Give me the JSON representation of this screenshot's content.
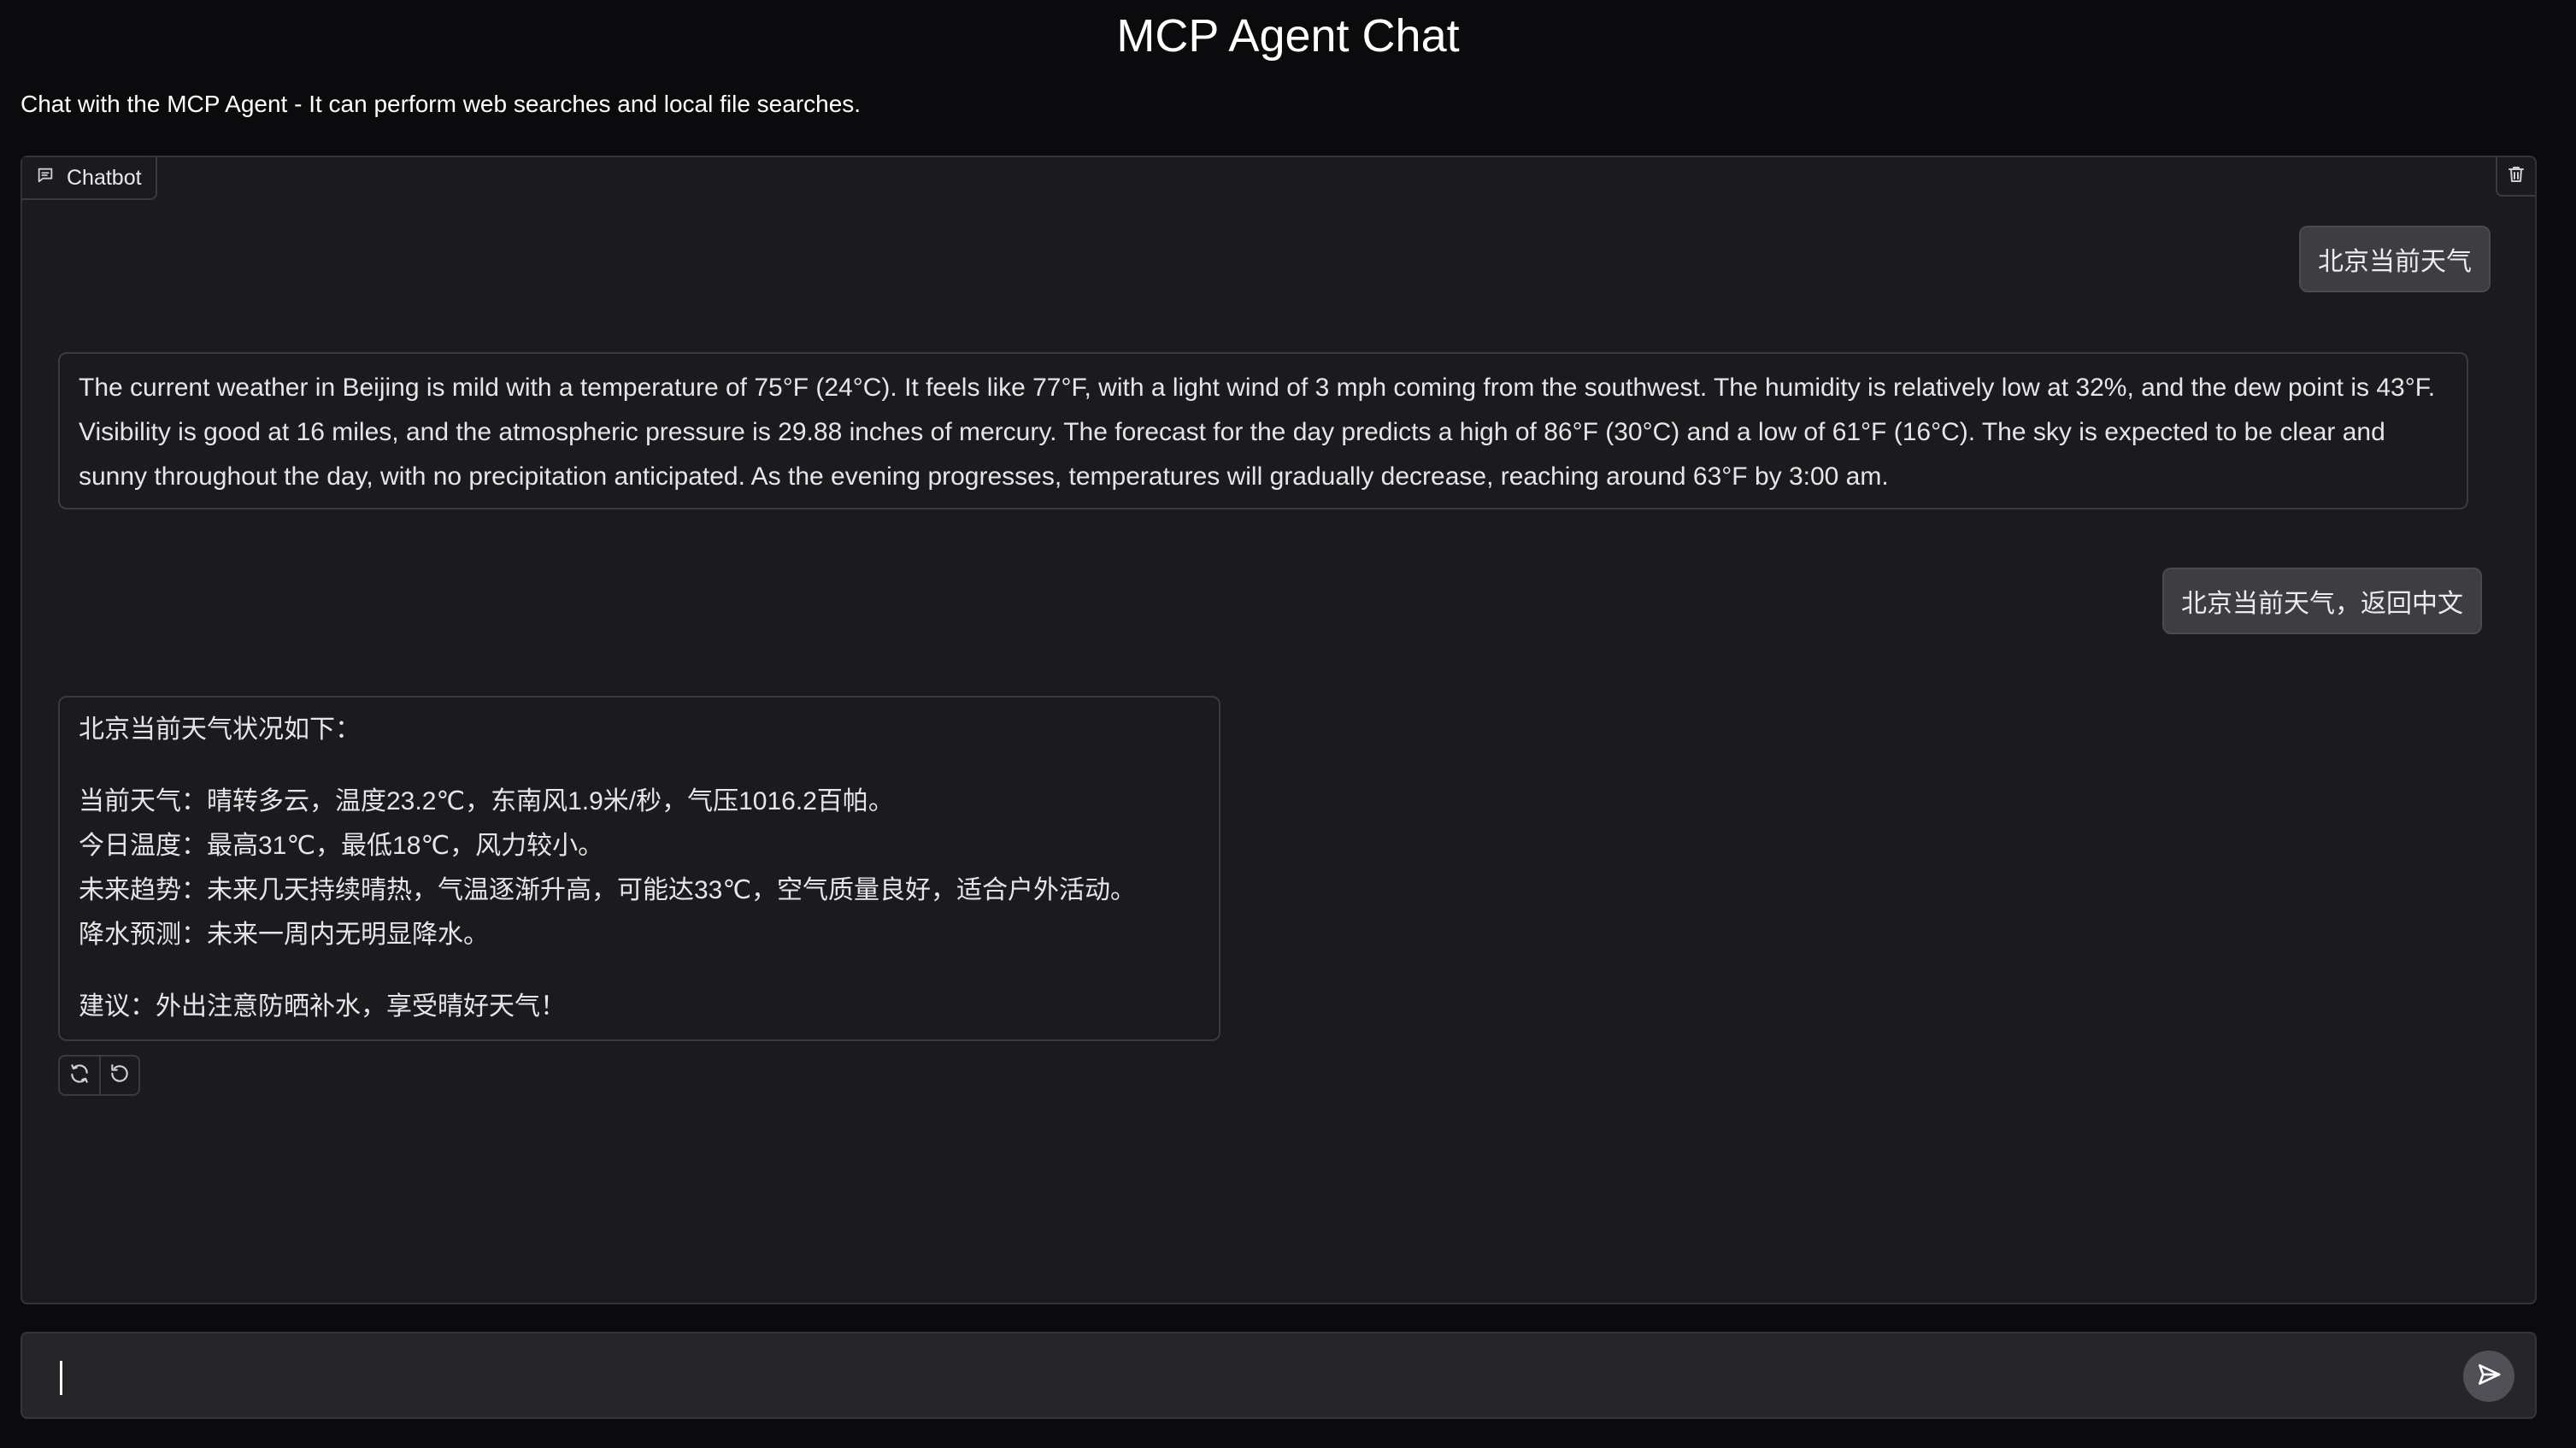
{
  "header": {
    "title": "MCP Agent Chat",
    "description": "Chat with the MCP Agent - It can perform web searches and local file searches."
  },
  "chatbot": {
    "label": "Chatbot",
    "label_icon": "chat-bubble-icon",
    "clear_icon": "trash-icon",
    "messages": [
      {
        "role": "user",
        "text": "北京当前天气"
      },
      {
        "role": "assistant",
        "text": "The current weather in Beijing is mild with a temperature of 75°F (24°C). It feels like 77°F, with a light wind of 3 mph coming from the southwest. The humidity is relatively low at 32%, and the dew point is 43°F. Visibility is good at 16 miles, and the atmospheric pressure is 29.88 inches of mercury. The forecast for the day predicts a high of 86°F (30°C) and a low of 61°F (16°C). The sky is expected to be clear and sunny throughout the day, with no precipitation anticipated. As the evening progresses, temperatures will gradually decrease, reaching around 63°F by 3:00 am."
      },
      {
        "role": "user",
        "text": "北京当前天气，返回中文"
      },
      {
        "role": "assistant",
        "lines": [
          "北京当前天气状况如下：",
          "当前天气：晴转多云，温度23.2℃，东南风1.9米/秒，气压1016.2百帕。",
          "今日温度：最高31℃，最低18℃，风力较小。",
          "未来趋势：未来几天持续晴热，气温逐渐升高，可能达33℃，空气质量良好，适合户外活动。",
          "降水预测：未来一周内无明显降水。",
          "建议：外出注意防晒补水，享受晴好天气！"
        ]
      }
    ],
    "actions": [
      "retry-icon",
      "undo-icon"
    ]
  },
  "input": {
    "value": "",
    "placeholder": "",
    "send_icon": "send-icon"
  },
  "colors": {
    "background": "#0b0b0d",
    "panel": "#1b1b1e",
    "user_bubble": "#3d3d42",
    "input_bg": "#262629"
  }
}
